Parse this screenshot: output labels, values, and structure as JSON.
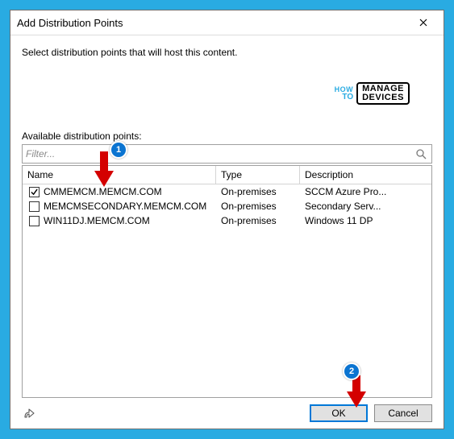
{
  "window": {
    "title": "Add Distribution Points"
  },
  "instruction": "Select distribution points that will host this content.",
  "watermark": {
    "how": "HOW",
    "to": "TO",
    "line1": "MANAGE",
    "line2": "DEVICES"
  },
  "available_label": "Available distribution points:",
  "filter": {
    "placeholder": "Filter..."
  },
  "columns": {
    "name": "Name",
    "type": "Type",
    "desc": "Description"
  },
  "rows": [
    {
      "checked": true,
      "name": "CMMEMCM.MEMCM.COM",
      "type": "On-premises",
      "desc": "SCCM Azure Pro..."
    },
    {
      "checked": false,
      "name": "MEMCMSECONDARY.MEMCM.COM",
      "type": "On-premises",
      "desc": "Secondary Serv..."
    },
    {
      "checked": false,
      "name": "WIN11DJ.MEMCM.COM",
      "type": "On-premises",
      "desc": "Windows 11 DP"
    }
  ],
  "buttons": {
    "ok": "OK",
    "cancel": "Cancel"
  },
  "annotations": {
    "badge1": "1",
    "badge2": "2"
  }
}
